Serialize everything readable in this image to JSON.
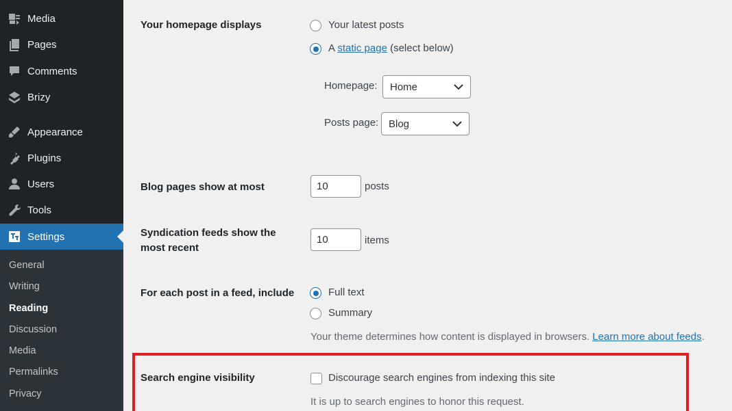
{
  "sidebar": {
    "items": [
      {
        "label": "Media",
        "icon": "media-icon"
      },
      {
        "label": "Pages",
        "icon": "pages-icon"
      },
      {
        "label": "Comments",
        "icon": "comments-icon"
      },
      {
        "label": "Brizy",
        "icon": "brizy-icon"
      },
      {
        "label": "Appearance",
        "icon": "appearance-icon"
      },
      {
        "label": "Plugins",
        "icon": "plugins-icon"
      },
      {
        "label": "Users",
        "icon": "users-icon"
      },
      {
        "label": "Tools",
        "icon": "tools-icon"
      },
      {
        "label": "Settings",
        "icon": "settings-icon",
        "active": true
      }
    ],
    "submenu": [
      "General",
      "Writing",
      "Reading",
      "Discussion",
      "Media",
      "Permalinks",
      "Privacy"
    ],
    "current_submenu": "Reading"
  },
  "homepage": {
    "label": "Your homepage displays",
    "option_latest": "Your latest posts",
    "option_static_prefix": "A",
    "option_static_link": "static page",
    "option_static_suffix": "(select below)",
    "selected": "static",
    "homepage_label": "Homepage:",
    "homepage_value": "Home",
    "posts_page_label": "Posts page:",
    "posts_page_value": "Blog"
  },
  "blog_pages": {
    "label": "Blog pages show at most",
    "value": "10",
    "suffix": "posts"
  },
  "syndication": {
    "label_line1": "Syndication feeds show the",
    "label_line2": "most recent",
    "value": "10",
    "suffix": "items"
  },
  "feed_include": {
    "label": "For each post in a feed, include",
    "option_full": "Full text",
    "option_summary": "Summary",
    "selected": "full",
    "description": "Your theme determines how content is displayed in browsers.",
    "learn_more": "Learn more about feeds",
    "learn_more_suffix": "."
  },
  "search_visibility": {
    "label": "Search engine visibility",
    "checkbox_label": "Discourage search engines from indexing this site",
    "checked": false,
    "note": "It is up to search engines to honor this request."
  },
  "colors": {
    "sidebar_bg": "#1d2327",
    "submenu_bg": "#2c3338",
    "accent": "#2271b1",
    "highlight": "#e01e1e",
    "page_bg": "#f0f0f1"
  }
}
